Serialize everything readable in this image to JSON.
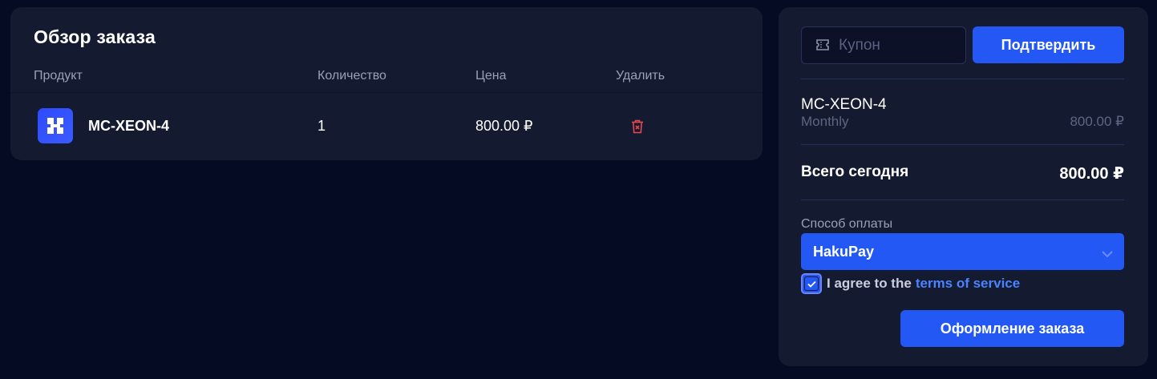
{
  "order": {
    "title": "Обзор заказа",
    "columns": {
      "product": "Продукт",
      "quantity": "Количество",
      "price": "Цена",
      "remove": "Удалить"
    },
    "items": [
      {
        "name": "MC-XEON-4",
        "quantity": "1",
        "price": "800.00 ₽"
      }
    ]
  },
  "summary": {
    "coupon_placeholder": "Купон",
    "confirm_label": "Подтвердить",
    "item_name": "MC-XEON-4",
    "item_period": "Monthly",
    "item_price": "800.00 ₽",
    "total_label": "Всего сегодня",
    "total_value": "800.00 ₽",
    "payment_label": "Способ оплаты",
    "payment_selected": "HakuPay",
    "agree_text": "I agree to the",
    "terms_link": "terms of service",
    "agree_checked": true,
    "checkout_label": "Оформление заказа"
  },
  "colors": {
    "background": "#050b22",
    "card": "#141b31",
    "accent": "#2358f5",
    "danger": "#e5484d",
    "link": "#4a82ff"
  },
  "icons": {
    "product": "pixel-logo-icon",
    "remove": "trash-icon",
    "coupon": "ticket-icon",
    "select": "chevron-down-icon",
    "checkbox": "check-icon"
  }
}
